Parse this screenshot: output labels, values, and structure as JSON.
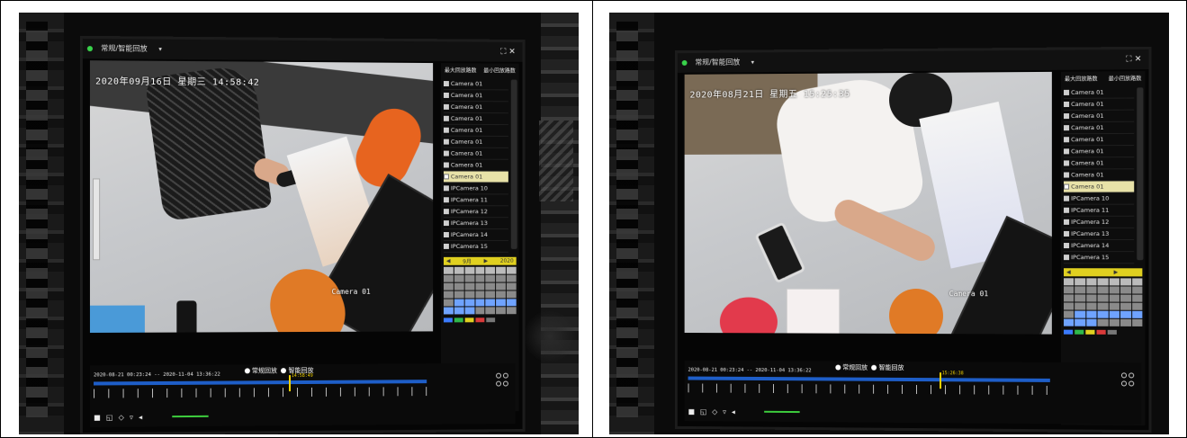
{
  "photos": [
    {
      "header_title": "常规/智能回放",
      "header_controls": "⛶ ✕",
      "osd_time": "2020年09月16日 星期三 14:58:42",
      "camera_label": "Camera 01",
      "panel_head_left": "最大回放路数",
      "panel_head_right": "最小回放路数",
      "cameras": [
        "Camera 01",
        "Camera 01",
        "Camera 01",
        "Camera 01",
        "Camera 01",
        "Camera 01",
        "Camera 01",
        "Camera 01",
        "Camera 01",
        "IPCamera 10",
        "IPCamera 11",
        "IPCamera 12",
        "IPCamera 13",
        "IPCamera 14",
        "IPCamera 15"
      ],
      "selected_camera_index": 8,
      "calendar_month": "9月",
      "calendar_year": "2020",
      "time_range": "2020-08-21 00:23:24 -- 2020-11-04 13:36:22",
      "mode_normal": "常规回放",
      "mode_smart": "智能回放",
      "cursor_time": "14:58:49",
      "cursor_fraction": 0.58
    },
    {
      "header_title": "常规/智能回放",
      "header_controls": "⛶ ✕",
      "osd_time": "2020年08月21日 星期五 15:25:35",
      "camera_label": "Camera 01",
      "panel_head_left": "最大回放路数",
      "panel_head_right": "最小回放路数",
      "cameras": [
        "Camera 01",
        "Camera 01",
        "Camera 01",
        "Camera 01",
        "Camera 01",
        "Camera 01",
        "Camera 01",
        "Camera 01",
        "Camera 01",
        "IPCamera 10",
        "IPCamera 11",
        "IPCamera 12",
        "IPCamera 13",
        "IPCamera 14",
        "IPCamera 15"
      ],
      "selected_camera_index": 8,
      "calendar_month": "",
      "calendar_year": "",
      "time_range": "2020-08-21 00:23:24 -- 2020-11-04 13:36:22",
      "mode_normal": "常规回放",
      "mode_smart": "智能回放",
      "cursor_time": "15:26:38",
      "cursor_fraction": 0.7
    }
  ],
  "colors": {
    "timeline_bar": "#1e5ec8",
    "cursor": "#f2d200",
    "calendar_accent": "#e0d020",
    "rec_indicator": "#39d34b"
  }
}
